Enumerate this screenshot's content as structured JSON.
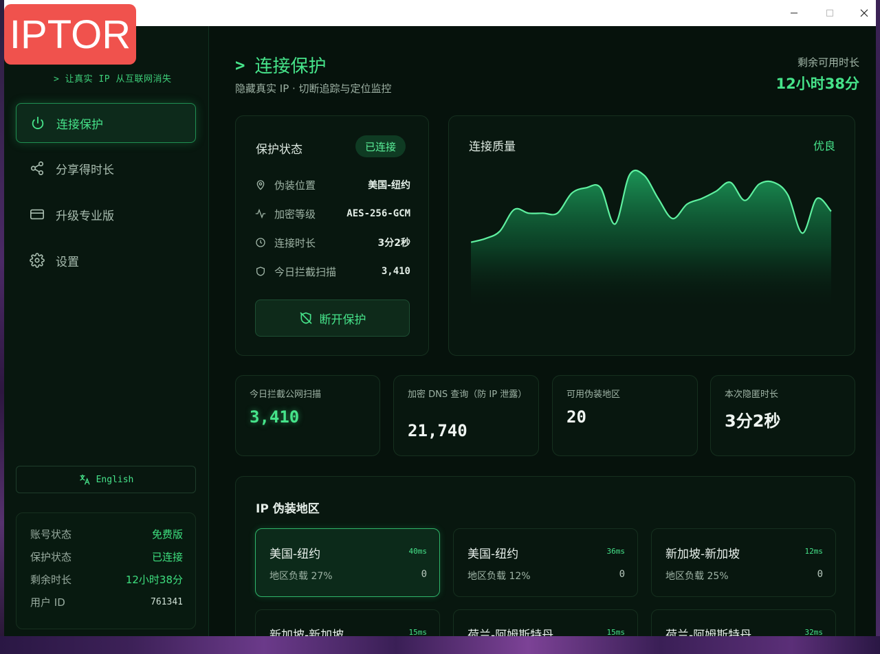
{
  "app": {
    "logo_text": "IPTOR",
    "tagline": "> 让真实 IP 从互联网消失"
  },
  "sidebar": {
    "items": [
      {
        "label": "连接保护",
        "icon": "power-icon",
        "active": true
      },
      {
        "label": "分享得时长",
        "icon": "share-icon",
        "active": false
      },
      {
        "label": "升级专业版",
        "icon": "credit-card-icon",
        "active": false
      },
      {
        "label": "设置",
        "icon": "gear-icon",
        "active": false
      }
    ],
    "language_button": "English",
    "account": {
      "rows": [
        {
          "key": "账号状态",
          "value": "免费版"
        },
        {
          "key": "保护状态",
          "value": "已连接"
        },
        {
          "key": "剩余时长",
          "value": "12小时38分"
        },
        {
          "key": "用户 ID",
          "value": "761341"
        }
      ]
    }
  },
  "header": {
    "title": "连接保护",
    "subtitle": "隐藏真实 IP · 切断追踪与定位监控",
    "remaining_label": "剩余可用时长",
    "remaining_value": "12小时38分"
  },
  "status_card": {
    "title": "保护状态",
    "badge": "已连接",
    "rows": [
      {
        "key": "伪装位置",
        "value": "美国-纽约",
        "icon": "location-pin-icon"
      },
      {
        "key": "加密等级",
        "value": "AES-256-GCM",
        "icon": "activity-icon"
      },
      {
        "key": "连接时长",
        "value": "3分2秒",
        "icon": "clock-icon"
      },
      {
        "key": "今日拦截扫描",
        "value": "3,410",
        "icon": "shield-icon"
      }
    ],
    "disconnect_label": "断开保护"
  },
  "quality_card": {
    "title": "连接质量",
    "value": "优良",
    "accent_color": "#3ee07f"
  },
  "chart_data": {
    "type": "area",
    "title": "连接质量",
    "values": [
      24,
      26,
      30,
      42,
      40,
      40,
      40,
      51,
      54,
      54,
      34,
      61,
      61,
      48,
      37,
      45,
      48,
      52,
      57,
      47,
      56,
      57,
      50,
      29,
      48,
      41
    ]
  },
  "stats": [
    {
      "label": "今日拦截公网扫描",
      "value": "3,410"
    },
    {
      "label": "加密 DNS 查询（防 IP 泄露）",
      "value": "21,740"
    },
    {
      "label": "可用伪装地区",
      "value": "20"
    },
    {
      "label": "本次隐匿时长",
      "value": "3分2秒"
    }
  ],
  "regions": {
    "title": "IP 伪装地区",
    "items": [
      {
        "name": "美国-纽约",
        "ping": "40ms",
        "load": "地区负载 27%",
        "count": "0",
        "selected": true
      },
      {
        "name": "美国-纽约",
        "ping": "36ms",
        "load": "地区负载 12%",
        "count": "0",
        "selected": false
      },
      {
        "name": "新加坡-新加坡",
        "ping": "12ms",
        "load": "地区负载 25%",
        "count": "0",
        "selected": false
      },
      {
        "name": "新加坡-新加坡",
        "ping": "15ms",
        "load": "",
        "count": "",
        "selected": false
      },
      {
        "name": "荷兰-阿姆斯特丹",
        "ping": "15ms",
        "load": "",
        "count": "",
        "selected": false
      },
      {
        "name": "荷兰-阿姆斯特丹",
        "ping": "32ms",
        "load": "",
        "count": "",
        "selected": false
      }
    ]
  }
}
